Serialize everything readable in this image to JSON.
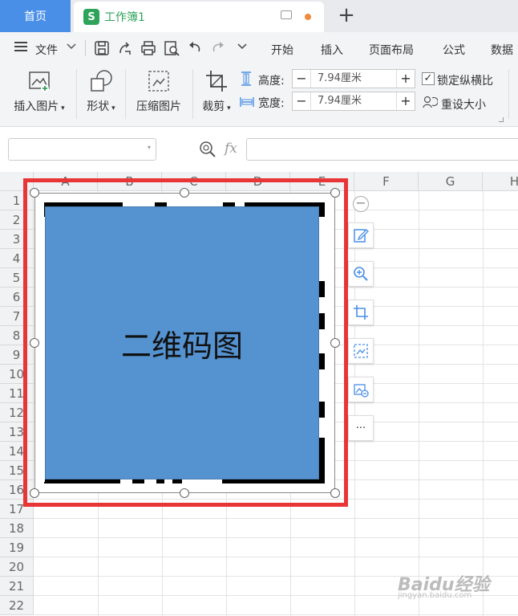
{
  "tabs": {
    "home": "首页",
    "workbook": "工作簿1",
    "logo": "S",
    "new_tab": "+"
  },
  "menu": {
    "file": "文件",
    "items": [
      "开始",
      "插入",
      "页面布局",
      "公式",
      "数据"
    ]
  },
  "ribbon": {
    "insert_picture": "插入图片",
    "shape": "形状",
    "compress_picture": "压缩图片",
    "crop": "裁剪",
    "height_label": "高度:",
    "height_value": "7.94厘米",
    "width_label": "宽度:",
    "width_value": "7.94厘米",
    "lock_ratio": "锁定纵横比",
    "reset_size": "重设大小",
    "lock_checked": true
  },
  "formula_bar": {
    "fx": "fx",
    "name_box_value": "",
    "formula_value": ""
  },
  "sheet": {
    "columns": [
      "A",
      "B",
      "C",
      "D",
      "E",
      "F",
      "G",
      "H"
    ],
    "rows": [
      "1",
      "2",
      "3",
      "4",
      "5",
      "6",
      "7",
      "8",
      "9",
      "10",
      "11",
      "12",
      "13",
      "14",
      "15",
      "16",
      "17",
      "18",
      "19",
      "20",
      "21",
      "22"
    ]
  },
  "picture": {
    "label": "二维码图",
    "fill_color": "#5592d0",
    "highlight_color": "#e83535"
  },
  "side_tools": [
    "minus-icon",
    "edit-icon",
    "zoom-icon",
    "crop-icon",
    "picture-icon",
    "replace-picture-icon",
    "more-icon"
  ],
  "side_more": "···",
  "watermark": {
    "brand": "Baidu经验",
    "url": "jingyan.baidu.com"
  }
}
